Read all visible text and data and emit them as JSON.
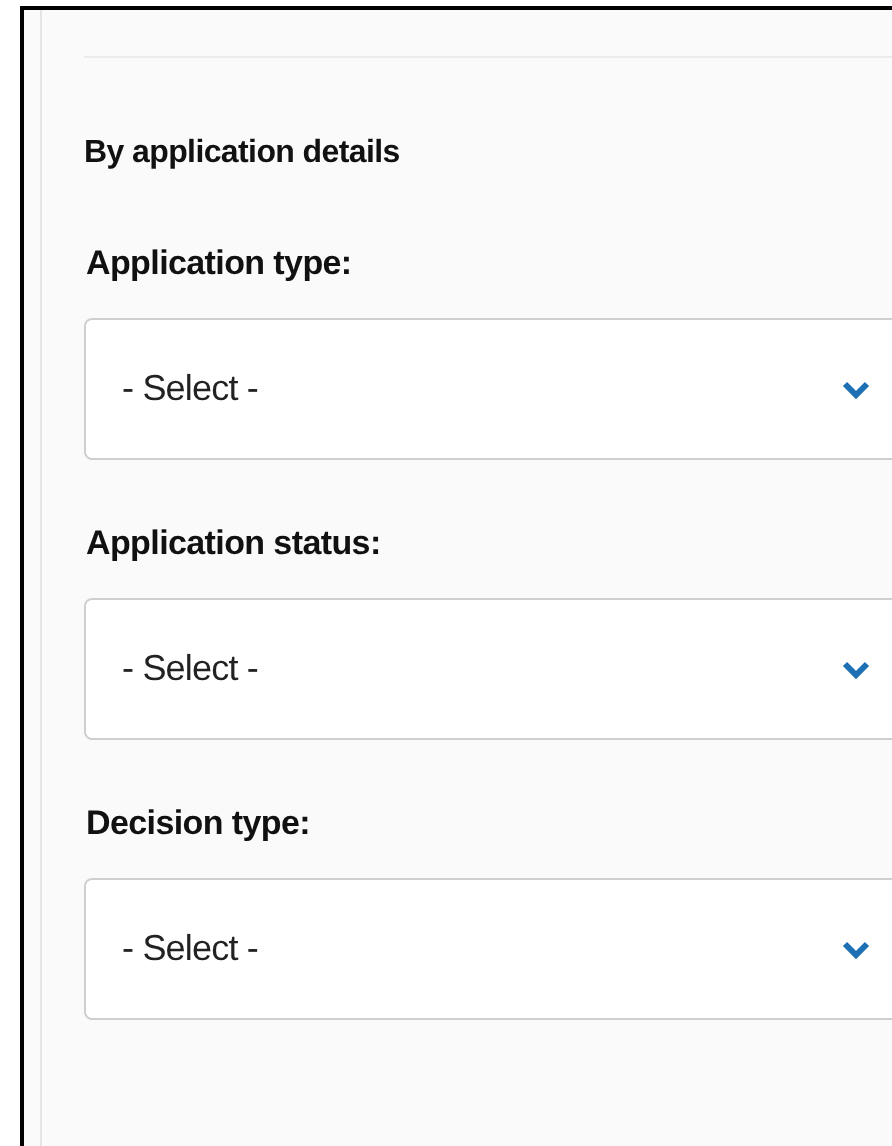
{
  "section": {
    "heading": "By application details"
  },
  "filters": [
    {
      "label": "Application type:",
      "value": "- Select -"
    },
    {
      "label": "Application status:",
      "value": "- Select -"
    },
    {
      "label": "Decision type:",
      "value": "- Select -"
    }
  ]
}
